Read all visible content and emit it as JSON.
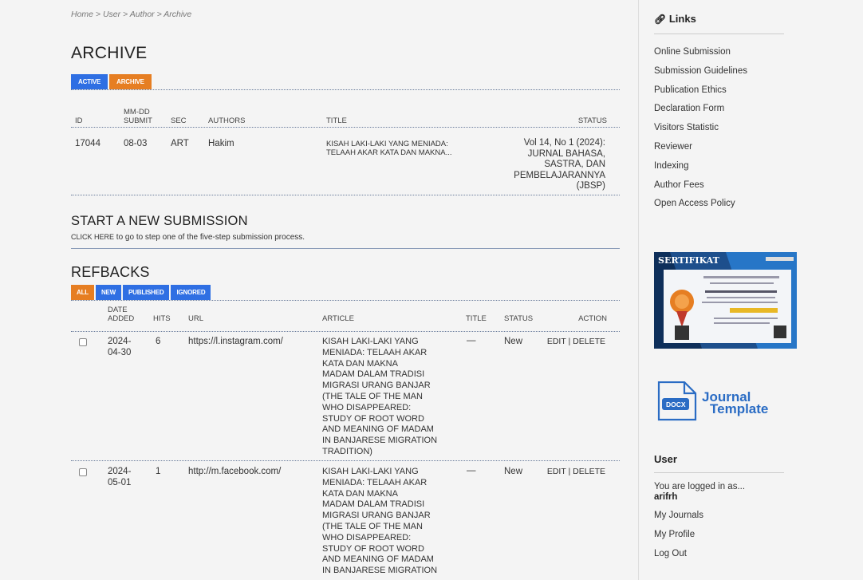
{
  "breadcrumb": "Home > User > Author > Archive",
  "page_title": "ARCHIVE",
  "archive_tabs": [
    "ACTIVE",
    "ARCHIVE"
  ],
  "archive_table": {
    "headers": {
      "id": "ID",
      "submit_line1": "MM-DD",
      "submit_line2": "SUBMIT",
      "sec": "SEC",
      "authors": "AUTHORS",
      "title": "TITLE",
      "status": "STATUS"
    },
    "row": {
      "id": "17044",
      "submit": "08-03",
      "sec": "ART",
      "authors": "Hakim",
      "title_line1": "KISAH LAKI-LAKI YANG MENIADA:",
      "title_line2": "TELAAH AKAR KATA DAN MAKNA...",
      "status_lines": [
        "Vol 14, No 1 (2024):",
        "JURNAL BAHASA,",
        "SASTRA, DAN",
        "PEMBELAJARANNYA",
        "(JBSP)"
      ]
    }
  },
  "new_submission": {
    "title": "START A NEW SUBMISSION",
    "link": "CLICK HERE",
    "text": "to go to step one of the five-step submission process."
  },
  "refbacks": {
    "title": "REFBACKS",
    "tabs": [
      "ALL",
      "NEW",
      "PUBLISHED",
      "IGNORED"
    ],
    "headers": {
      "date_line1": "DATE",
      "date_line2": "ADDED",
      "hits": "HITS",
      "url": "URL",
      "article": "ARTICLE",
      "title": "TITLE",
      "status": "STATUS",
      "action": "ACTION"
    },
    "rows": [
      {
        "date_line1": "2024-",
        "date_line2": "04-30",
        "hits": "6",
        "url": "https://l.instagram.com/",
        "article_lines": [
          "KISAH LAKI-LAKI YANG",
          "MENIADA: TELAAH AKAR",
          "KATA DAN MAKNA",
          "MADAM DALAM TRADISI",
          "MIGRASI URANG BANJAR",
          "(THE TALE OF THE MAN",
          "WHO DISAPPEARED:",
          "STUDY OF ROOT WORD",
          "AND MEANING OF MADAM",
          "IN BANJARESE MIGRATION",
          "TRADITION)"
        ],
        "title": "—",
        "status": "New",
        "edit": "EDIT",
        "delete": "DELETE"
      },
      {
        "date_line1": "2024-",
        "date_line2": "05-01",
        "hits": "1",
        "url": "http://m.facebook.com/",
        "article_lines": [
          "KISAH LAKI-LAKI YANG",
          "MENIADA: TELAAH AKAR",
          "KATA DAN MAKNA",
          "MADAM DALAM TRADISI",
          "MIGRASI URANG BANJAR",
          "(THE TALE OF THE MAN",
          "WHO DISAPPEARED:",
          "STUDY OF ROOT WORD",
          "AND MEANING OF MADAM",
          "IN BANJARESE MIGRATION"
        ],
        "title": "—",
        "status": "New",
        "edit": "EDIT",
        "delete": "DELETE"
      }
    ]
  },
  "sidebar": {
    "links_title": "Links",
    "links": [
      "Online Submission",
      "Submission Guidelines",
      "Publication Ethics",
      "Declaration Form",
      "Visitors Statistic",
      "Reviewer",
      "Indexing",
      "Author Fees",
      "Open Access Policy"
    ],
    "certificate_label": "SERTIFIKAT",
    "template_badge": "DOCX",
    "template_line1": "Journal",
    "template_line2": "Template",
    "user_title": "User",
    "logged_in_text": "You are logged in as...",
    "username": "arifrh",
    "user_links": [
      "My Journals",
      "My Profile",
      "Log Out"
    ]
  },
  "colors": {
    "blue_button": "#2f6fe3",
    "orange_button": "#e67e22",
    "template_blue": "#2a6cc4"
  }
}
